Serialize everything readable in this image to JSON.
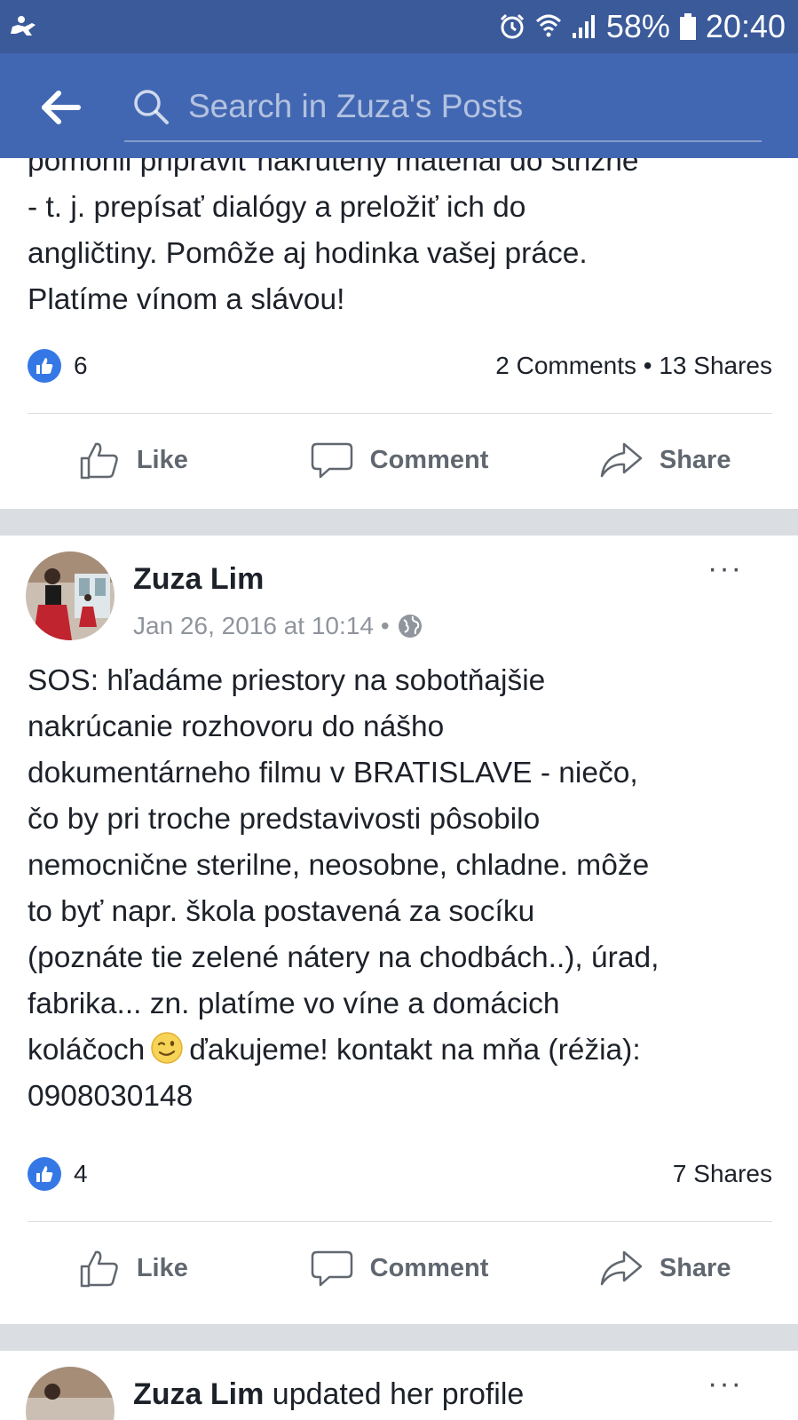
{
  "status_bar": {
    "battery": "58%",
    "time": "20:40",
    "icons": [
      "notification-icon",
      "alarm-icon",
      "wifi-icon",
      "signal-icon",
      "battery-icon"
    ]
  },
  "app_bar": {
    "search_placeholder": "Search in Zuza's Posts",
    "colors": {
      "statusbar": "#3b5a9a",
      "appbar": "#4267b2"
    }
  },
  "posts": [
    {
      "text_lines": [
        "pomohli pripraviť nakrútený materiál do strižne",
        "- t. j. prepísať dialógy a preložiť ich do",
        "angličtiny. Pomôže aj hodinka vašej práce.",
        "Platíme vínom a slávou!"
      ],
      "likes": "6",
      "counts": "2 Comments • 13 Shares",
      "actions": {
        "like": "Like",
        "comment": "Comment",
        "share": "Share"
      }
    },
    {
      "author": "Zuza Lim",
      "timestamp": "Jan 26, 2016 at 10:14",
      "separator": "•",
      "more": "···",
      "text_lines": [
        "SOS: hľadáme priestory na sobotňajšie",
        "nakrúcanie rozhovoru do nášho",
        "dokumentárneho filmu v BRATISLAVE - niečo,",
        "čo by pri troche predstavivosti pôsobilo",
        "nemocnične sterilne, neosobne, chladne. môže",
        "to byť napr. škola postavená za socíku",
        "(poznáte tie zelené nátery na chodbách..), úrad,",
        "fabrika... zn. platíme vo víne a domácich"
      ],
      "line_with_emoji_before": "koláčoch",
      "line_with_emoji_after": "ďakujeme! kontakt na mňa (réžia):",
      "last_line": "0908030148",
      "likes": "4",
      "counts": "7 Shares",
      "actions": {
        "like": "Like",
        "comment": "Comment",
        "share": "Share"
      }
    },
    {
      "author": "Zuza Lim",
      "suffix": " updated her profile",
      "more": "···"
    }
  ],
  "colors": {
    "like_blue": "#3578e5",
    "separator": "#dadde1",
    "meta_gray": "#90949c"
  }
}
